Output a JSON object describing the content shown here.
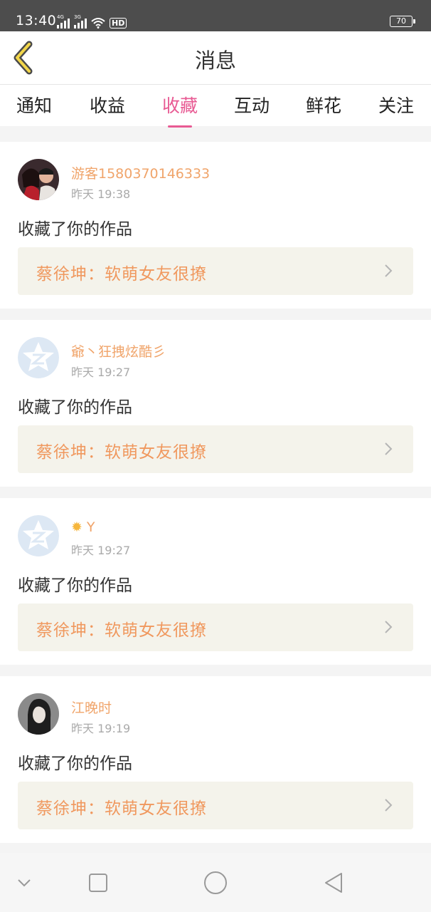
{
  "status_bar": {
    "time": "13:40",
    "net1": "4G",
    "net2": "3G",
    "hd": "HD",
    "battery": "70"
  },
  "header": {
    "title": "消息"
  },
  "tabs": [
    {
      "label": "通知",
      "active": false
    },
    {
      "label": "收益",
      "active": false
    },
    {
      "label": "收藏",
      "active": true
    },
    {
      "label": "互动",
      "active": false
    },
    {
      "label": "鲜花",
      "active": false
    },
    {
      "label": "关注",
      "active": false
    }
  ],
  "colors": {
    "accent": "#e85a93",
    "username": "#f0a46a",
    "work_title": "#f0985e",
    "work_bg": "#f4f3eb"
  },
  "messages": [
    {
      "username": "游客1580370146333",
      "time": "昨天 19:38",
      "action": "收藏了你的作品",
      "work_title": "蔡徐坤：软萌女友很撩",
      "avatar": "photo-avatar"
    },
    {
      "username": "爺丶狂拽炫酷彡",
      "time": "昨天 19:27",
      "action": "收藏了你的作品",
      "work_title": "蔡徐坤：软萌女友很撩",
      "avatar": "default-z-avatar"
    },
    {
      "username": "Y",
      "username_icon": "sun-icon",
      "time": "昨天 19:27",
      "action": "收藏了你的作品",
      "work_title": "蔡徐坤：软萌女友很撩",
      "avatar": "default-z-avatar"
    },
    {
      "username": "江晚时",
      "time": "昨天 19:19",
      "action": "收藏了你的作品",
      "work_title": "蔡徐坤：软萌女友很撩",
      "avatar": "photo-avatar"
    }
  ],
  "navbar": {
    "icons": [
      "chevron-down-icon",
      "square-icon",
      "circle-icon",
      "triangle-back-icon"
    ]
  }
}
